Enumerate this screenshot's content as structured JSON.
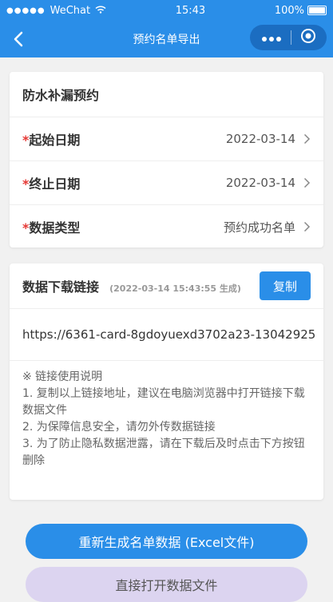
{
  "status_bar": {
    "signal_dots": "●●●●●",
    "carrier": "WeChat",
    "time": "15:43",
    "battery_pct": "100%"
  },
  "nav": {
    "title": "预约名单导出"
  },
  "booking_card": {
    "title": "防水补漏预约",
    "required_mark": "*",
    "rows": [
      {
        "label": "起始日期",
        "value": "2022-03-14"
      },
      {
        "label": "终止日期",
        "value": "2022-03-14"
      },
      {
        "label": "数据类型",
        "value": "预约成功名单"
      }
    ]
  },
  "download_card": {
    "title": "数据下载链接",
    "generated": "(2022-03-14 15:43:55 生成)",
    "copy_label": "复制",
    "link": "https://6361-card-8gdoyuexd3702a23-13042925",
    "notes": [
      "※ 链接使用说明",
      "1. 复制以上链接地址，建议在电脑浏览器中打开链接下载数据文件",
      "2. 为保障信息安全，请勿外传数据链接",
      "3. 为了防止隐私数据泄露，请在下载后及时点击下方按钮删除"
    ]
  },
  "buttons": {
    "regenerate": "重新生成名单数据 (Excel文件)",
    "open_file": "直接打开数据文件"
  },
  "colors": {
    "primary": "#2a8ee8",
    "required": "#e53935",
    "open_button_bg": "#dcd4f0"
  }
}
